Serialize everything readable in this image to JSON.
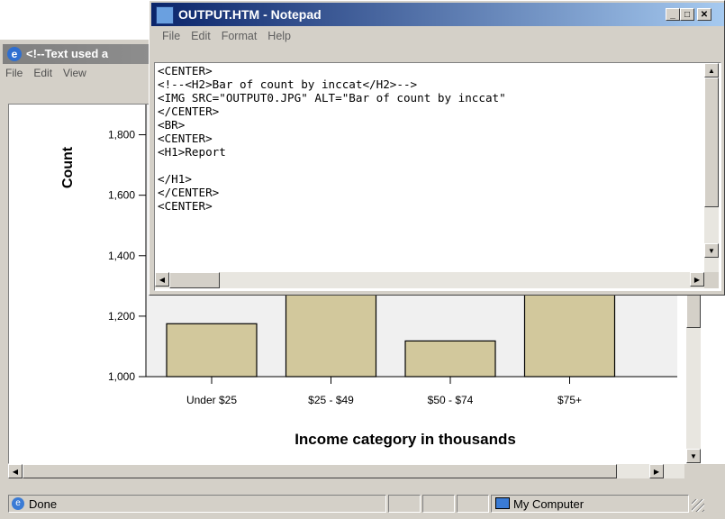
{
  "browser": {
    "title": "<!--Text used a",
    "menu": [
      "File",
      "Edit",
      "View"
    ],
    "status_text": "Done",
    "zone_text": "My Computer"
  },
  "notepad": {
    "title": "OUTPUT.HTM - Notepad",
    "menu": [
      "File",
      "Edit",
      "Format",
      "Help"
    ],
    "lines": [
      "<CENTER>",
      "<!--<H2>Bar of count by inccat</H2>-->",
      "<IMG SRC=\"OUTPUT0.JPG\" ALT=\"Bar of count by inccat\"",
      "</CENTER>",
      "<BR>",
      "<CENTER>",
      "<H1>Report",
      "",
      "</H1>",
      "</CENTER>",
      "<CENTER>"
    ]
  },
  "chart_data": {
    "type": "bar",
    "categories": [
      "Under $25",
      "$25 - $49",
      "$50 - $74",
      "$75+"
    ],
    "values": [
      1175,
      1290,
      1118,
      1290
    ],
    "xlabel": "Income category in thousands",
    "ylabel": "Count",
    "yticks": [
      "1,000",
      "1,200",
      "1,400",
      "1,600",
      "1,800"
    ],
    "ylim": [
      1000,
      1900
    ],
    "bar_color": "#d2c89c"
  },
  "colors": {
    "chart_bg": "#f0f0f0",
    "title_active": "#0a246a",
    "title_inactive": "#808080"
  }
}
